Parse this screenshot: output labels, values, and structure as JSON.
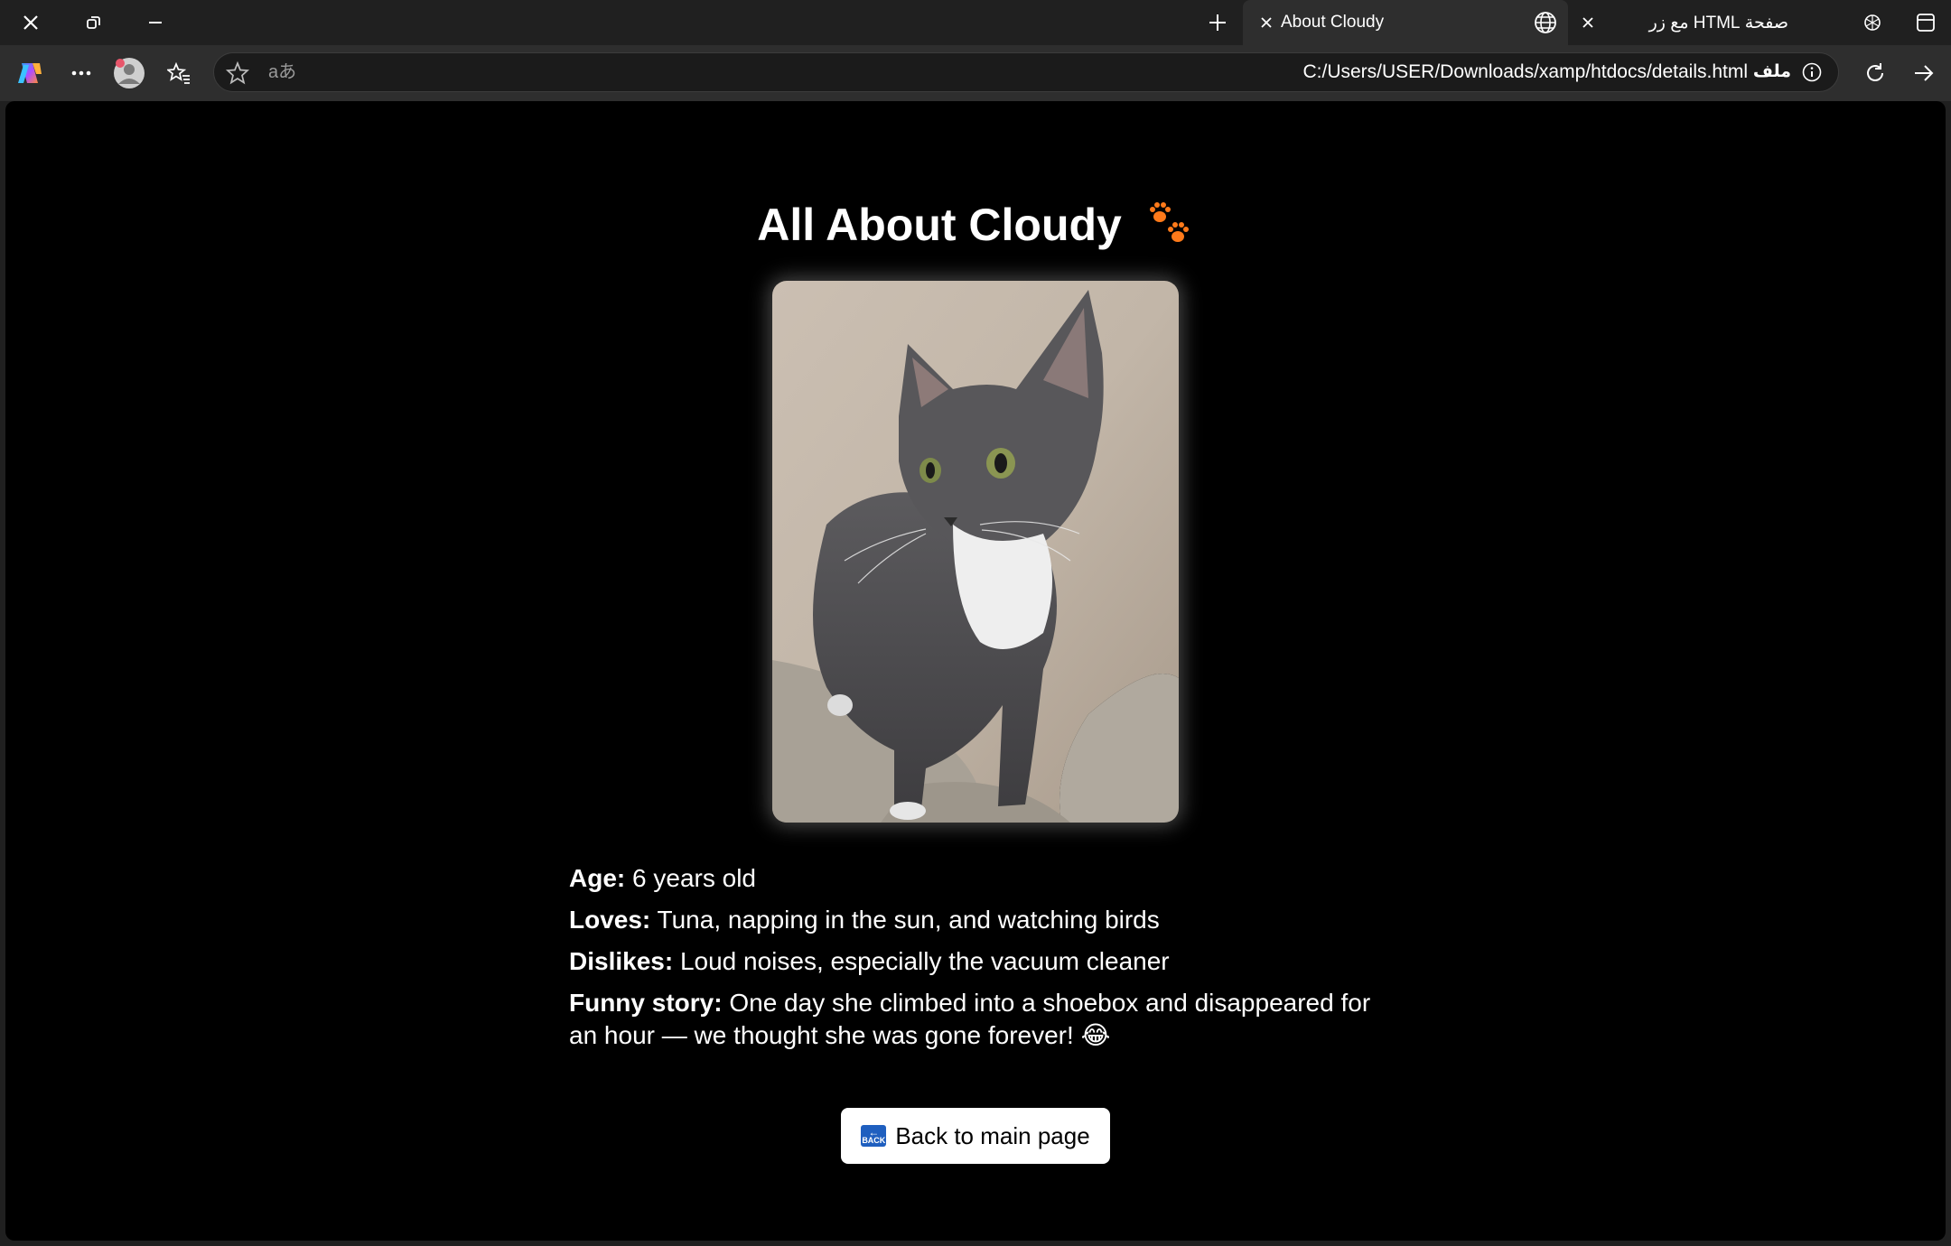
{
  "browser": {
    "tabs": [
      {
        "title": "About Cloudy",
        "active": true
      },
      {
        "title": "صفحة HTML مع زر",
        "active": false
      }
    ],
    "address_bar": {
      "url": "C:/Users/USER/Downloads/xamp/htdocs/details.html",
      "file_chip": "ملف",
      "translate_glyph": "aあ"
    },
    "icons": [
      "close-window-icon",
      "restore-icon",
      "minimize-icon",
      "new-tab-icon",
      "globe-icon",
      "tab-close-icon",
      "chatgpt-icon",
      "sidebar-layout-icon",
      "copilot-icon",
      "more-icon",
      "profile-icon",
      "favorites-icon",
      "star-icon",
      "info-icon",
      "refresh-icon",
      "forward-icon"
    ]
  },
  "page": {
    "title": "All About Cloudy",
    "title_emoji": "paw-prints-icon",
    "details": [
      {
        "label": "Age:",
        "text": "6 years old"
      },
      {
        "label": "Loves:",
        "text": "Tuna, napping in the sun, and watching birds"
      },
      {
        "label": "Dislikes:",
        "text": "Loud noises, especially the vacuum cleaner"
      },
      {
        "label": "Funny story:",
        "text": "One day she climbed into a shoebox and disappeared for an hour — we thought she was gone forever! 😂"
      }
    ],
    "back_button": {
      "label": "Back to main page",
      "icon_text": "BACK"
    }
  },
  "colors": {
    "page_bg": "#000000",
    "chrome_bg": "#202020",
    "toolbar_bg": "#2e2e2e",
    "paw": "#ff7a1a",
    "back_icon": "#1f5fbf"
  }
}
